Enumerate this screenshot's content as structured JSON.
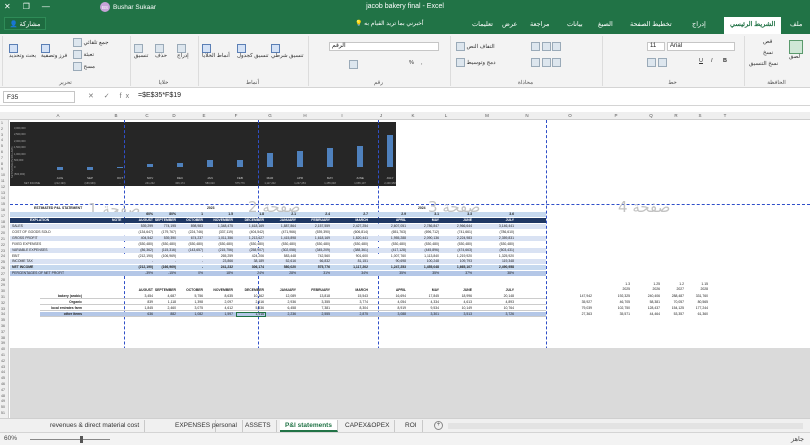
{
  "window": {
    "title": "jacob bakery final  -  Excel",
    "user_name": "Bushar Sukaar",
    "user_initials": "BS",
    "min": "—",
    "max": "❐",
    "close": "✕"
  },
  "ribbon_tabs": {
    "file": "ملف",
    "home": "الشريط الرئيسي",
    "insert": "إدراج",
    "page_layout": "تخطيط الصفحة",
    "formulas": "الصيغ",
    "data": "بيانات",
    "review": "مراجعة",
    "view": "عرض",
    "help": "تعليمات",
    "tell_me": "أخبرني بما تريد القيام به",
    "share": "مشاركة"
  },
  "ribbon": {
    "clipboard": {
      "label": "الحافظة",
      "paste": "لصق",
      "cut": "قص",
      "copy": "نسخ",
      "format_painter": "نسخ التنسيق"
    },
    "font": {
      "label": "خط",
      "name": "Arial",
      "size": "11",
      "bold": "B",
      "italic": "I",
      "underline": "U"
    },
    "alignment": {
      "label": "محاذاة",
      "wrap": "التفاف النص",
      "merge": "دمج وتوسيط"
    },
    "number": {
      "label": "رقم",
      "format": "الرقم",
      "percent": "%",
      "comma": ","
    },
    "styles": {
      "label": "أنماط",
      "conditional": "تنسيق شرطي",
      "as_table": "تنسيق كجدول",
      "cell_styles": "أنماط الخلايا"
    },
    "cells": {
      "label": "خلايا",
      "insert": "إدراج",
      "delete": "حذف",
      "format": "تنسيق"
    },
    "editing": {
      "label": "تحرير",
      "autosum": "جمع تلقائي",
      "fill": "تعبئة",
      "clear": "مسح",
      "sort": "فرز وتصفية",
      "find": "بحث وتحديد"
    }
  },
  "formula_bar": {
    "name_box": "F35",
    "formula": "=$E$35*F$19",
    "fx_buttons": "✕ ✓ fx"
  },
  "columns": [
    "A",
    "B",
    "C",
    "D",
    "E",
    "F",
    "G",
    "H",
    "I",
    "J",
    "K",
    "L",
    "M",
    "N",
    "O",
    "P",
    "Q",
    "R",
    "S",
    "T"
  ],
  "rows": [
    "1",
    "2",
    "3",
    "4",
    "5",
    "6",
    "7",
    "8",
    "9",
    "10",
    "11",
    "12",
    "13",
    "14",
    "15",
    "16",
    "17",
    "18",
    "19",
    "20",
    "21",
    "22",
    "23",
    "24",
    "25",
    "26",
    "27",
    "28",
    "29",
    "30",
    "31",
    "32",
    "33",
    "34",
    "35",
    "36",
    "37",
    "38",
    "39",
    "40",
    "41",
    "42",
    "43",
    "44",
    "45",
    "46",
    "47",
    "48",
    "49",
    "50",
    "51"
  ],
  "chart_data": {
    "type": "bar",
    "title": "",
    "ylabel": "NET INCOME (IN DOLLARS)",
    "xlabel": "NET INCOME",
    "yticks": [
      "3,000,000",
      "2,500,000",
      "2,000,000",
      "1,500,000",
      "1,000,000",
      "500,000",
      "0",
      "(500,000)"
    ],
    "ylim": [
      -500000,
      3000000
    ],
    "categories": [
      "AUG",
      "SEP",
      "OCT",
      "NOV",
      "DEC",
      "JAN",
      "FEB",
      "MAR",
      "APR",
      "MAY",
      "JUNE",
      "JULY"
    ],
    "values": [
      -212190,
      -166969,
      0,
      241232,
      306174,
      580020,
      575776,
      1117202,
      1247253,
      1455048,
      1665107,
      2490958
    ],
    "value_labels": [
      "(212,190)",
      "(166,969)",
      "-",
      "241,232",
      "306,174",
      "580,020",
      "575,776",
      "1,117,202",
      "1,247,253",
      "1,455,048",
      "1,665,107",
      "2,490,958"
    ],
    "grid": false,
    "legend": "none"
  },
  "watermarks": [
    "صفحة 1",
    "صفحة 2",
    "صفحة 3",
    "صفحة 4"
  ],
  "statement": {
    "title": "ESTIMATED P&L STATEMENT",
    "years": [
      "2023",
      "2024"
    ],
    "growth_row": [
      "60%",
      "80%",
      "1",
      "1.5",
      "1.8",
      "2.1",
      "2.4",
      "2.7",
      "2.9",
      "3.1",
      "3.3",
      "3.6"
    ],
    "header": [
      "EXPLATION",
      "NOTE",
      "AUGUST",
      "SEPTEMBER",
      "OCTOBER",
      "NOVEMBER",
      "DECEMBER",
      "JANUARY",
      "FEBRUARY",
      "MARCH",
      "APRIL",
      "MAY",
      "JUNE",
      "JULY"
    ],
    "rows": [
      {
        "label": "SALES",
        "values": [
          "539,299",
          "774,195",
          "898,983",
          "1,348,475",
          "1,618,169",
          "1,887,864",
          "2,157,559",
          "2,427,254",
          "2,607,051",
          "2,786,847",
          "2,966,644",
          "3,146,441"
        ]
      },
      {
        "label": "COST OF GOODS SOLD",
        "values": [
          "(134,647)",
          "(179,767)",
          "(224,746)",
          "(337,119)",
          "(404,542)",
          "(471,966)",
          "(539,390)",
          "(606,814)",
          "(651,763)",
          "(696,712)",
          "(741,661)",
          "(786,610)"
        ]
      },
      {
        "label": "GROSS PROFIT",
        "values": [
          "404,542",
          "539,390",
          "674,237",
          "1,011,356",
          "1,213,627",
          "1,415,898",
          "1,618,169",
          "1,820,441",
          "1,955,288",
          "2,090,136",
          "2,224,983",
          "2,359,831"
        ]
      },
      {
        "label": "FIXED EXPENSES",
        "values": [
          "(530,480)",
          "(530,480)",
          "(530,480)",
          "(530,480)",
          "(530,480)",
          "(530,480)",
          "(530,480)",
          "(530,480)",
          "(530,480)",
          "(530,480)",
          "(530,480)",
          "(530,480)"
        ]
      },
      {
        "label": "VARIABLE EXPENSES",
        "values": [
          "(86,362)",
          "(115,316)",
          "(143,657)",
          "(215,756)",
          "(258,907)",
          "(302,058)",
          "(345,209)",
          "(388,361)",
          "(417,128)",
          "(445,896)",
          "(474,663)",
          "(503,431)"
        ]
      },
      {
        "label": "EBIT",
        "values": [
          "(212,190)",
          "(106,969)",
          "-",
          "265,259",
          "424,206",
          "583,448",
          "742,560",
          "901,600",
          "1,007,760",
          "1,113,840",
          "1,219,920",
          "1,325,920"
        ]
      },
      {
        "label": "INCOME TAX",
        "values": [
          "-",
          "-",
          "-",
          "23,866",
          "38,189",
          "52,616",
          "66,832",
          "81,151",
          "90,698",
          "100,248",
          "109,793",
          "119,348"
        ]
      },
      {
        "label": "NET INCOME",
        "values": [
          "(212,190)",
          "(166,969)",
          "-",
          "241,232",
          "306,174",
          "580,020",
          "575,776",
          "1,117,202",
          "1,247,253",
          "1,455,048",
          "1,665,107",
          "2,490,958"
        ]
      },
      {
        "label": "PERCENTAGES OF NET PROFIT",
        "values": [
          "-39%",
          "-15%",
          "0%",
          "18%",
          "24%",
          "28%",
          "31%",
          "34%",
          "35%",
          "35%",
          "37%",
          "38%"
        ]
      }
    ]
  },
  "breakdown": {
    "header": [
      "AUGUST",
      "SEPTEMBER",
      "OCTOBER",
      "NOVEMBER",
      "DECEMBER",
      "JANUARY",
      "FEBRUARY",
      "MARCH",
      "APRIL",
      "MAY",
      "JUNE",
      "JULY"
    ],
    "rows": [
      {
        "label": "bakery (arabic)",
        "values": [
          "3,454",
          "4,687",
          "5,756",
          "8,635",
          "10,362",
          "12,089",
          "13,818",
          "15,543",
          "16,694",
          "17,845",
          "18,996",
          "20,148"
        ]
      },
      {
        "label": "Organic",
        "values": [
          "839",
          "1,118",
          "1,398",
          "2,097",
          "2,516",
          "2,936",
          "3,355",
          "3,774",
          "4,054",
          "4,334",
          "4,613",
          "4,893"
        ]
      },
      {
        "label": "local emirates farm",
        "values": [
          "1,845",
          "2,460",
          "3,075",
          "4,612",
          "5,536",
          "6,458",
          "7,381",
          "8,304",
          "8,919",
          "9,534",
          "10,149",
          "10,764"
        ]
      },
      {
        "label": "other items",
        "values": [
          "636",
          "882",
          "1,082",
          "1,597",
          "1,916",
          "2,236",
          "2,555",
          "2,875",
          "3,088",
          "3,301",
          "3,513",
          "3,726"
        ]
      }
    ],
    "mult_row": [
      "1.3",
      "1.25",
      "1.2",
      "1.15"
    ],
    "future_years": [
      "2025",
      "2026",
      "2027",
      "2028"
    ],
    "future": [
      [
        "147,942",
        "192,325",
        "240,406",
        "288,487",
        "331,760"
      ],
      [
        "35,927",
        "46,705",
        "58,381",
        "70,057",
        "80,565"
      ],
      [
        "79,039",
        "102,750",
        "128,437",
        "154,125",
        "177,244"
      ],
      [
        "27,363",
        "35,571",
        "44,464",
        "53,357",
        "61,360"
      ]
    ]
  },
  "sheet_tabs": [
    "revenues & direct material cost",
    "EXPENSES",
    "personal",
    "ASSETS",
    "P&l statements",
    "CAPEX&OPEX",
    "ROI"
  ],
  "active_tab": "P&l statements",
  "status": {
    "zoom": "60%",
    "ready": "جاهز"
  }
}
